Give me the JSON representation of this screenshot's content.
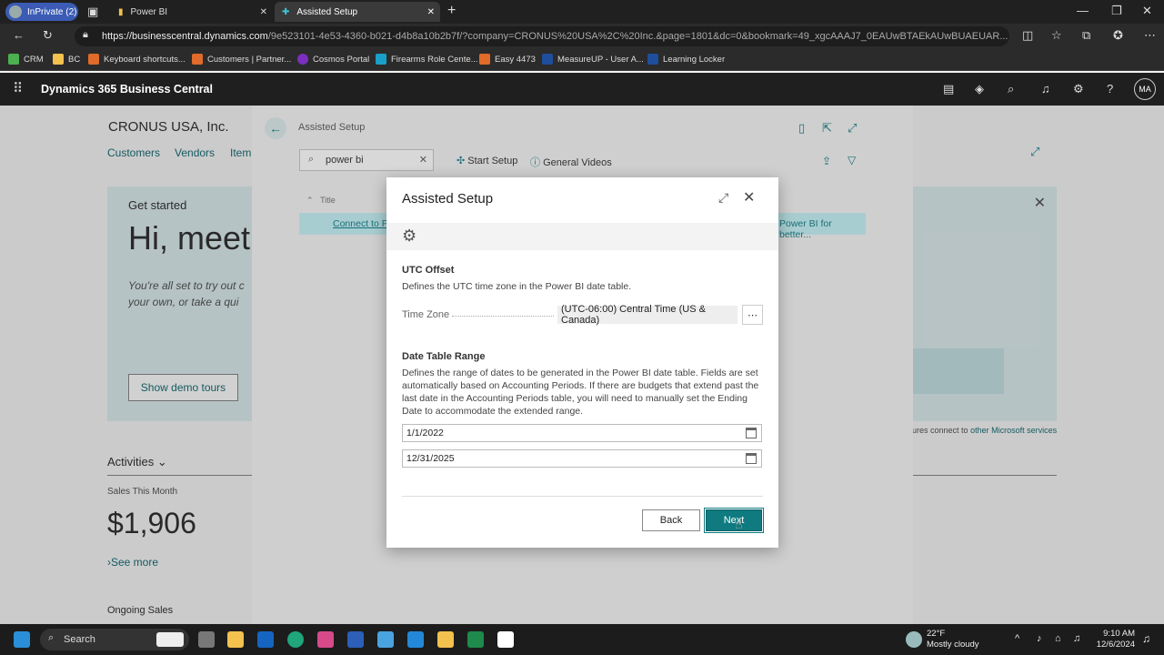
{
  "browser": {
    "inprivate_label": "InPrivate (2)",
    "tabs": [
      {
        "label": "Power BI"
      },
      {
        "label": "Assisted Setup"
      }
    ],
    "url_host": "https://businesscentral.dynamics.com",
    "url_path": "/9e523101-4e53-4360-b021-d4b8a10b2b7f/?company=CRONUS%20USA%2C%20Inc.&page=1801&dc=0&bookmark=49_xgcAAAJ7_0EAUwBTAEkAUwBUAEUAR...",
    "bookmarks": [
      {
        "label": "CRM",
        "color": "#4caf50"
      },
      {
        "label": "BC",
        "color": "#f2c14e"
      },
      {
        "label": "Keyboard shortcuts...",
        "color": "#e06b2a"
      },
      {
        "label": "Customers | Partner...",
        "color": "#e06b2a"
      },
      {
        "label": "Cosmos Portal",
        "color": "#7b2fbe"
      },
      {
        "label": "Firearms Role Cente...",
        "color": "#1aa0c8"
      },
      {
        "label": "Easy 4473",
        "color": "#e06b2a"
      },
      {
        "label": "MeasureUP - User A...",
        "color": "#1f4e9c"
      },
      {
        "label": "Learning Locker",
        "color": "#1f4e9c"
      }
    ]
  },
  "app": {
    "title": "Dynamics 365 Business Central",
    "avatar_initials": "MA"
  },
  "background": {
    "company": "CRONUS USA, Inc.",
    "menu": [
      "Customers",
      "Vendors",
      "Item"
    ],
    "get_started": "Get started",
    "hi_meet": "Hi, meet",
    "intro": "You're all set to try out c your own, or take a qui",
    "demo_button": "Show demo tours",
    "activities": "Activities",
    "sales_label": "Sales This Month",
    "sales_value": "$1,906",
    "see_more": "See more",
    "ongoing_sales": "Ongoing Sales",
    "right_link_prefix": "ures connect to",
    "right_link": "other Microsoft services"
  },
  "list_page": {
    "title": "Assisted Setup",
    "search_value": "power bi",
    "start_setup": "Start Setup",
    "general_videos": "General Videos",
    "col_title": "Title",
    "row_link": "Connect to P",
    "row_desc": "Power BI for better..."
  },
  "dialog": {
    "title": "Assisted Setup",
    "utc_heading": "UTC Offset",
    "utc_desc": "Defines the UTC time zone in the Power BI date table.",
    "tz_label": "Time Zone",
    "tz_value": "(UTC-06:00) Central Time (US & Canada)",
    "tz_button": "⋯",
    "range_heading": "Date Table Range",
    "range_desc": "Defines the range of dates to be generated in the Power BI date table. Fields are set automatically based on Accounting Periods. If there are budgets that extend past the last date in the Accounting Periods table, you will need to manually set the Ending Date to accommodate the extended range.",
    "start_date": "1/1/2022",
    "end_date": "12/31/2025",
    "back_label": "Back",
    "next_label": "Next"
  },
  "taskbar": {
    "search_label": "Search",
    "weather_temp": "22°F",
    "weather_desc": "Mostly cloudy",
    "time": "9:10 AM",
    "date": "12/6/2024"
  },
  "colors": {
    "accent": "#0f7b80",
    "link": "#1a6f78"
  }
}
